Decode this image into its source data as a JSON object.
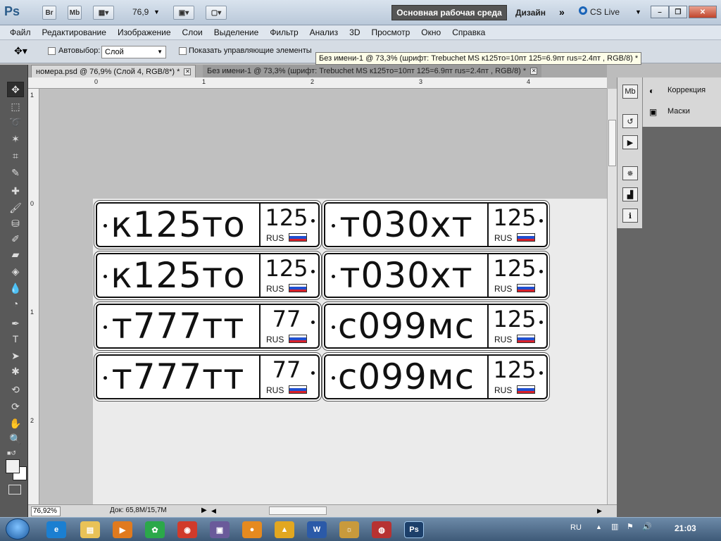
{
  "app": {
    "logo": "Ps",
    "bridge": "Br",
    "minibridge": "Mb",
    "zoom": "76,9",
    "workspace_active": "Основная рабочая среда",
    "workspace_design": "Дизайн",
    "cslive": "CS Live"
  },
  "menu": [
    "Файл",
    "Редактирование",
    "Изображение",
    "Слои",
    "Выделение",
    "Фильтр",
    "Анализ",
    "3D",
    "Просмотр",
    "Окно",
    "Справка"
  ],
  "options": {
    "autoselect_label": "Автовыбор:",
    "autoselect_value": "Слой",
    "show_controls_label": "Показать управляющие элементы"
  },
  "tooltip": "Без имени-1 @ 73,3% (шрифт: Trebuchet MS  к125то=10пт 125=6.9пт rus=2.4пт , RGB/8) *",
  "tabs": [
    {
      "label": "номера.psd @ 76,9% (Слой 4, RGB/8*) *"
    },
    {
      "label": "Без имени-1 @ 73,3% (шрифт: Trebuchet MS  к125то=10пт 125=6.9пт rus=2.4пт , RGB/8) *"
    }
  ],
  "ruler": {
    "h": [
      "0",
      "1",
      "2",
      "3",
      "4"
    ],
    "v": [
      "1",
      "0",
      "1",
      "2"
    ]
  },
  "plates": [
    {
      "number": "к125то",
      "region": "125",
      "country": "RUS"
    },
    {
      "number": "т030хт",
      "region": "125",
      "country": "RUS"
    },
    {
      "number": "к125то",
      "region": "125",
      "country": "RUS"
    },
    {
      "number": "т030хт",
      "region": "125",
      "country": "RUS"
    },
    {
      "number": "т777тт",
      "region": "77",
      "country": "RUS"
    },
    {
      "number": "с099мс",
      "region": "125",
      "country": "RUS"
    },
    {
      "number": "т777тт",
      "region": "77",
      "country": "RUS"
    },
    {
      "number": "с099мс",
      "region": "125",
      "country": "RUS"
    }
  ],
  "status": {
    "zoom": "76,92%",
    "doc": "Док: 65,8M/15,7M"
  },
  "panels": {
    "correction": "Коррекция",
    "masks": "Маски"
  },
  "taskbar": {
    "lang": "RU",
    "time": "21:03"
  },
  "colors": {
    "flag_white": "#ffffff",
    "flag_blue": "#1f4fd0",
    "flag_red": "#d8202a"
  }
}
